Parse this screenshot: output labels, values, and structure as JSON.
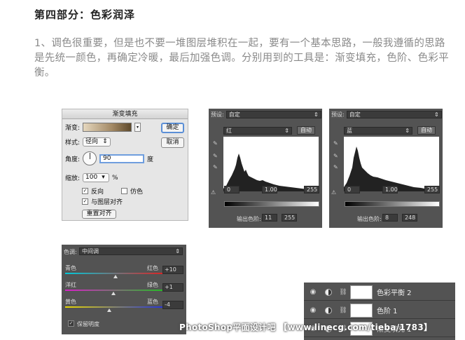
{
  "heading": "第四部分：色彩润泽",
  "paragraph": "1、调色很重要，但是也不要一堆图层堆积在一起，要有一个基本思路，一般我遵循的思路是先统一颜色，再确定冷暖，最后加强色调。分别用到的工具是：渐变填充，色阶、色彩平衡。",
  "gradient_fill": {
    "title": "渐变填充",
    "gradient_label": "渐变:",
    "style_label": "样式:",
    "style_value": "径向",
    "angle_label": "角度:",
    "angle_value": "90",
    "angle_unit": "度",
    "scale_label": "缩放:",
    "scale_value": "100",
    "scale_unit": "%",
    "reverse_label": "反向",
    "dither_label": "仿色",
    "align_label": "与图层对齐",
    "reset_align": "重置对齐",
    "ok": "确定",
    "cancel": "取消",
    "gradient_colors": [
      "#e5d7be",
      "#a38965",
      "#5e4a2c"
    ]
  },
  "levels": [
    {
      "preset_label": "预设:",
      "preset_value": "自定",
      "channel": "红",
      "auto": "自动",
      "input_black": "0",
      "input_mid": "1.00",
      "input_white": "255",
      "output_label": "输出色阶:",
      "output_black": "11",
      "output_white": "255"
    },
    {
      "preset_label": "预设:",
      "preset_value": "自定",
      "channel": "蓝",
      "auto": "自动",
      "input_black": "0",
      "input_mid": "1.00",
      "input_white": "255",
      "output_label": "输出色阶:",
      "output_black": "8",
      "output_white": "248"
    }
  ],
  "color_balance": {
    "tone_label": "色调:",
    "tone_value": "中间调",
    "sliders": [
      {
        "left": "青色",
        "right": "红色",
        "value": "+10",
        "colors": [
          "#00c8d8",
          "#e02020"
        ]
      },
      {
        "left": "洋红",
        "right": "绿色",
        "value": "+1",
        "colors": [
          "#d820c8",
          "#20c020"
        ]
      },
      {
        "left": "黄色",
        "right": "蓝色",
        "value": "-4",
        "colors": [
          "#e8d800",
          "#2030e0"
        ]
      }
    ],
    "preserve_label": "保留明度"
  },
  "layers": [
    {
      "name": "色彩平衡 2"
    },
    {
      "name": "色阶 1"
    },
    {
      "name": "渐变填充 1"
    }
  ],
  "watermark": "PhotoShop平面设计吧 【www.linecg.com/tieba/1783】"
}
